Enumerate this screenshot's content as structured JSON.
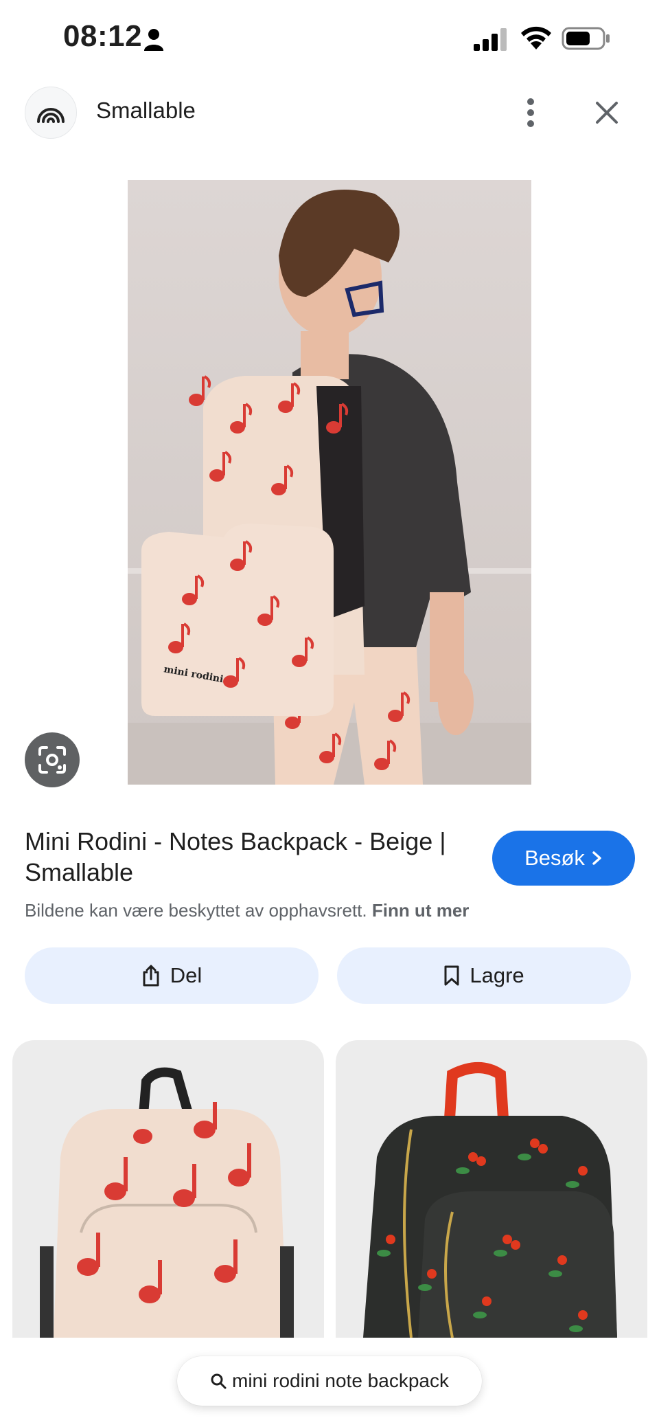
{
  "status_bar": {
    "time": "08:12",
    "icons": [
      "person-icon",
      "signal-icon",
      "wifi-icon",
      "battery-icon"
    ]
  },
  "header": {
    "site_name": "Smallable",
    "logo_icon": "rainbow-logo-icon",
    "more_icon": "more-vertical-icon",
    "close_icon": "close-icon"
  },
  "image": {
    "brand_text": "mini rodini"
  },
  "result": {
    "title": "Mini Rodini - Notes Backpack - Beige | Smallable",
    "visit_label": "Besøk",
    "copyright_text": "Bildene kan være beskyttet av opphavsrett.",
    "learn_more": "Finn ut mer"
  },
  "actions": {
    "share_label": "Del",
    "save_label": "Lagre"
  },
  "search": {
    "query": "mini rodini note backpack"
  },
  "colors": {
    "accent": "#1a73e8",
    "action_bg": "#e8f0fe",
    "backpack_beige": "#f1ddcf",
    "note_red": "#d93b34"
  }
}
